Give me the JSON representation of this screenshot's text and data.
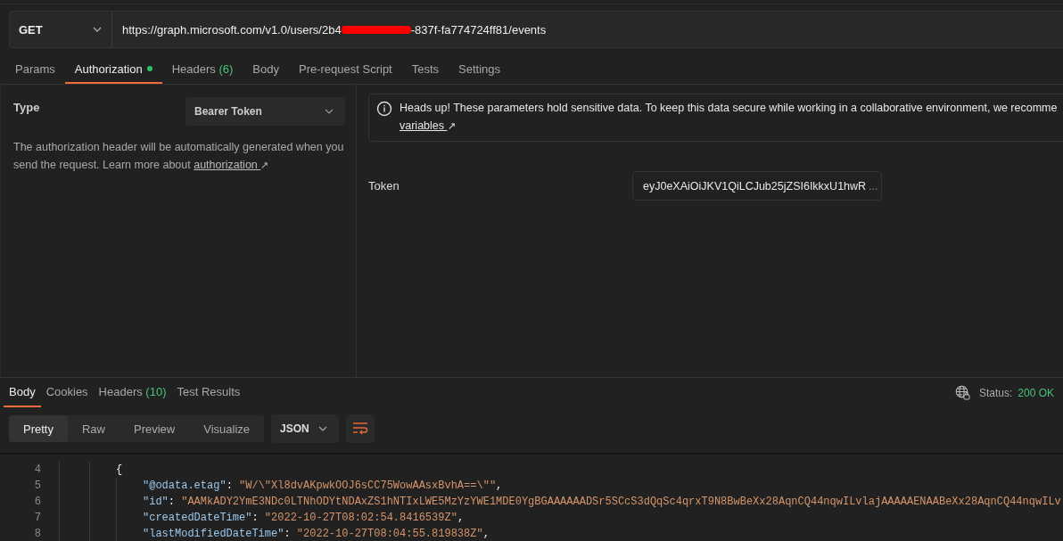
{
  "request": {
    "method": "GET",
    "url_start": "https://graph.microsoft.com/v1.0/users/2b4",
    "url_redacted": true,
    "url_end": "-837f-fa774724ff81/events"
  },
  "tabs": [
    {
      "label": "Params",
      "selected": false
    },
    {
      "label": "Authorization",
      "selected": true,
      "indicator": true
    },
    {
      "label": "Headers",
      "count": "(6)",
      "selected": false
    },
    {
      "label": "Body",
      "selected": false
    },
    {
      "label": "Pre-request Script",
      "selected": false
    },
    {
      "label": "Tests",
      "selected": false
    },
    {
      "label": "Settings",
      "selected": false
    }
  ],
  "auth": {
    "type_label": "Type",
    "type_value": "Bearer Token",
    "description": "The authorization header will be automatically generated when you send the request. Learn more about",
    "link": "authorization",
    "link_arrow": "↗"
  },
  "notice": {
    "text": "Heads up! These parameters hold sensitive data. To keep this data secure while working in a collaborative environment, we recomme",
    "link": "variables",
    "link_arrow": "↗"
  },
  "token": {
    "label": "Token",
    "value": "eyJ0eXAiOiJKV1QiLCJub25jZSI6IkkxU1hwR",
    "ellipsis": "..."
  },
  "response": {
    "tabs": [
      {
        "label": "Body",
        "selected": true
      },
      {
        "label": "Cookies",
        "selected": false
      },
      {
        "label": "Headers",
        "count": "(10)",
        "selected": false
      },
      {
        "label": "Test Results",
        "selected": false
      }
    ],
    "status_label": "Status:",
    "status_value": "200 OK",
    "views": [
      {
        "label": "Pretty",
        "selected": true
      },
      {
        "label": "Raw",
        "selected": false
      },
      {
        "label": "Preview",
        "selected": false
      },
      {
        "label": "Visualize",
        "selected": false
      }
    ],
    "format": "JSON"
  },
  "code": [
    {
      "number": "4",
      "tokens": [
        {
          "kind": "punct",
          "text": "{"
        }
      ],
      "children": [
        {
          "number": "5",
          "tokens": [
            {
              "kind": "key",
              "text": "\"@odata.etag\""
            },
            {
              "kind": "punct",
              "text": ": "
            },
            {
              "kind": "string",
              "text": "\"W/\\\"Xl8dvAKpwkOOJ6sCC75WowAAsxBvhA==\\\"\""
            },
            {
              "kind": "punct",
              "text": ","
            }
          ]
        },
        {
          "number": "6",
          "tokens": [
            {
              "kind": "key",
              "text": "\"id\""
            },
            {
              "kind": "punct",
              "text": ": "
            },
            {
              "kind": "string",
              "text": "\"AAMkADY2YmE3NDc0LTNhODYtNDAxZS1hNTIxLWE5MzYzYWE1MDE0YgBGAAAAAADSr5SCcS3dQqSc4qrxT9N8BwBeXx28AqnCQ44nqwILvlajAAAAAENAABeXx28AqnCQ44nqwILv"
            }
          ]
        },
        {
          "number": "7",
          "tokens": [
            {
              "kind": "key",
              "text": "\"createdDateTime\""
            },
            {
              "kind": "punct",
              "text": ": "
            },
            {
              "kind": "string",
              "text": "\"2022-10-27T08:02:54.8416539Z\""
            },
            {
              "kind": "punct",
              "text": ","
            }
          ]
        },
        {
          "number": "8",
          "tokens": [
            {
              "kind": "key",
              "text": "\"lastModifiedDateTime\""
            },
            {
              "kind": "punct",
              "text": ": "
            },
            {
              "kind": "string",
              "text": "\"2022-10-27T08:04:55.819838Z\""
            },
            {
              "kind": "punct",
              "text": ","
            }
          ]
        }
      ]
    }
  ]
}
